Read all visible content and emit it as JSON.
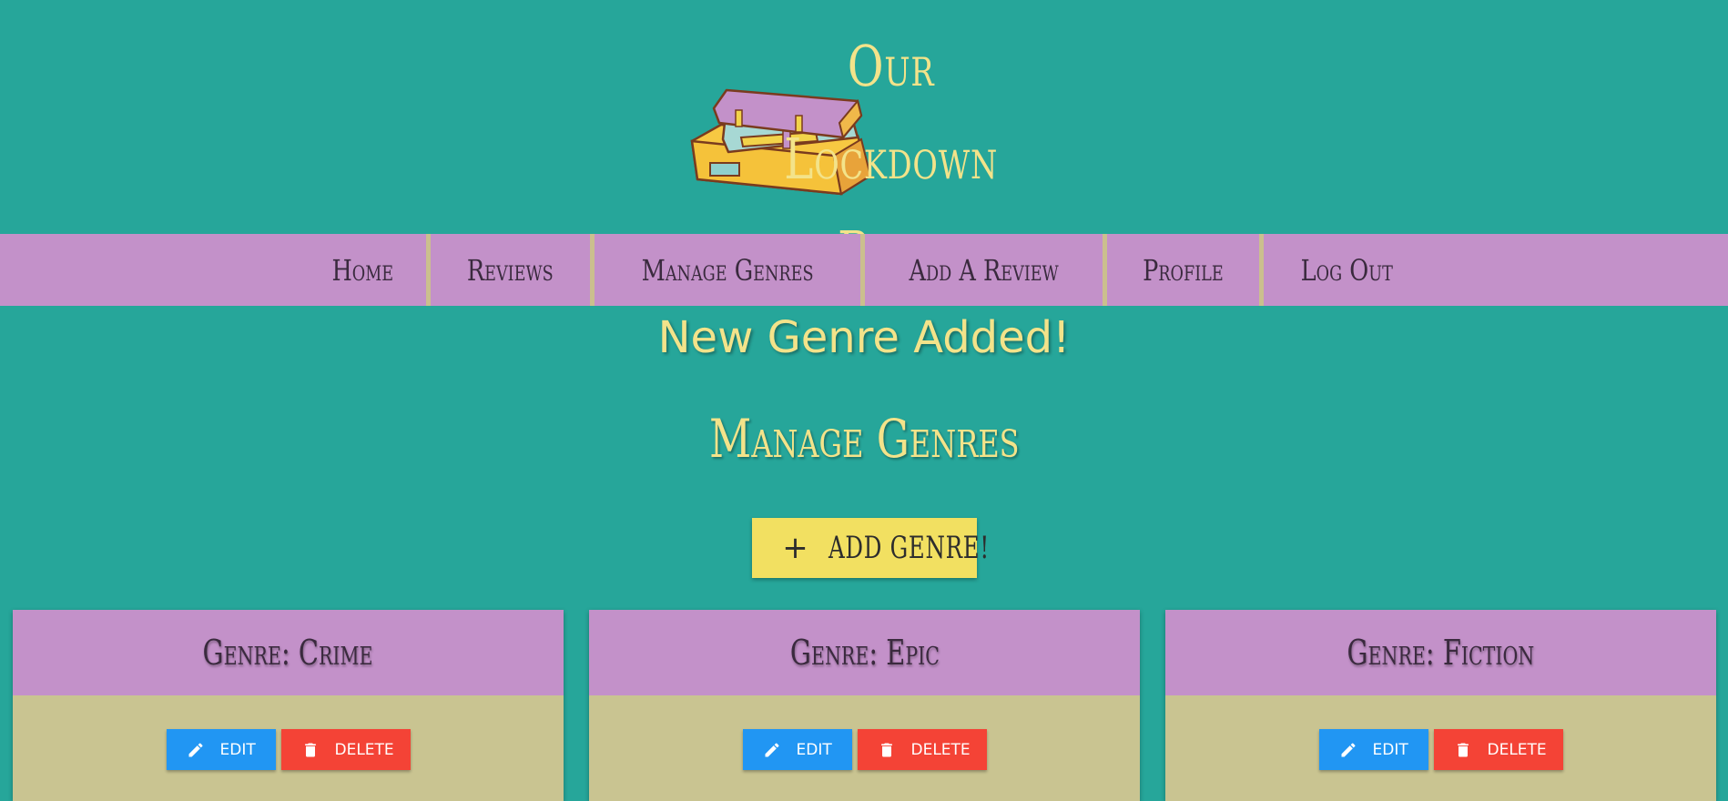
{
  "header": {
    "title_line1": "Our Lockdown",
    "title_line2": "Reads",
    "logo_icon": "books-stack-icon"
  },
  "nav": {
    "items": [
      {
        "label": "Home"
      },
      {
        "label": "Reviews"
      },
      {
        "label": "Manage Genres"
      },
      {
        "label": "Add A Review"
      },
      {
        "label": "Profile"
      },
      {
        "label": "Log Out"
      }
    ]
  },
  "flash": {
    "message": "New Genre Added!"
  },
  "main": {
    "title": "Manage Genres",
    "add_button": {
      "icon": "plus-icon",
      "label": "ADD GENRE!"
    }
  },
  "genres": [
    {
      "title": "Genre: Crime",
      "edit_label": "EDIT",
      "delete_label": "DELETE"
    },
    {
      "title": "Genre: Epic",
      "edit_label": "EDIT",
      "delete_label": "DELETE"
    },
    {
      "title": "Genre: Fiction",
      "edit_label": "EDIT",
      "delete_label": "DELETE"
    }
  ],
  "colors": {
    "background": "#26a69a",
    "nav": "#c391c9",
    "accent_yellow": "#f3e38a",
    "card_body": "#c9c491",
    "edit_button": "#2196f3",
    "delete_button": "#f44336"
  }
}
